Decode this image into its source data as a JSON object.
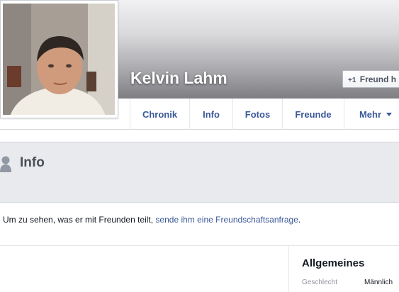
{
  "profile": {
    "name": "Kelvin Lahm",
    "add_friend_label": "Freund h",
    "add_friend_icon": "+1"
  },
  "tabs": [
    {
      "label": "Chronik"
    },
    {
      "label": "Info"
    },
    {
      "label": "Fotos"
    },
    {
      "label": "Freunde"
    },
    {
      "label": "Mehr"
    }
  ],
  "section": {
    "title": "Info",
    "icon": "person-icon"
  },
  "notice": {
    "prefix": "Um zu sehen, was er mit Freunden teilt, ",
    "link": "sende ihm eine Freundschaftsanfrage",
    "suffix": "."
  },
  "general": {
    "title": "Allgemeines",
    "gender_label": "Geschlecht",
    "gender_value": "Männlich"
  },
  "colors": {
    "link": "#3b5998",
    "band": "#e9eaed"
  }
}
